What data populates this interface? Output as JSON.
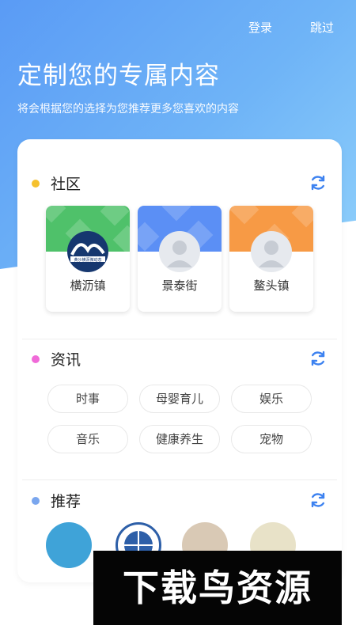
{
  "top_bar": {
    "login": "登录",
    "skip": "跳过"
  },
  "header": {
    "title": "定制您的专属内容",
    "subtitle": "将会根据您的选择为您推荐更多您喜欢的内容"
  },
  "sections": {
    "community": {
      "title": "社区",
      "dot_color": "#f5c12e",
      "cards": [
        {
          "name": "横沥镇",
          "banner_color": "#4fc16a",
          "logo_caption": "黄沙横沥微动态"
        },
        {
          "name": "景泰街",
          "banner_color": "#5b8ff5"
        },
        {
          "name": "鳌头镇",
          "banner_color": "#f79a45"
        }
      ]
    },
    "news": {
      "title": "资讯",
      "dot_color": "#f06ad8",
      "tags": [
        "时事",
        "母婴育儿",
        "娱乐",
        "音乐",
        "健康养生",
        "宠物"
      ]
    },
    "recommend": {
      "title": "推荐",
      "dot_color": "#7aa6ee"
    }
  },
  "colors": {
    "accent": "#3d82f0",
    "header_gradient_start": "#5a9bf5",
    "header_gradient_end": "#8fd0fb"
  },
  "watermark": "下载鸟资源"
}
